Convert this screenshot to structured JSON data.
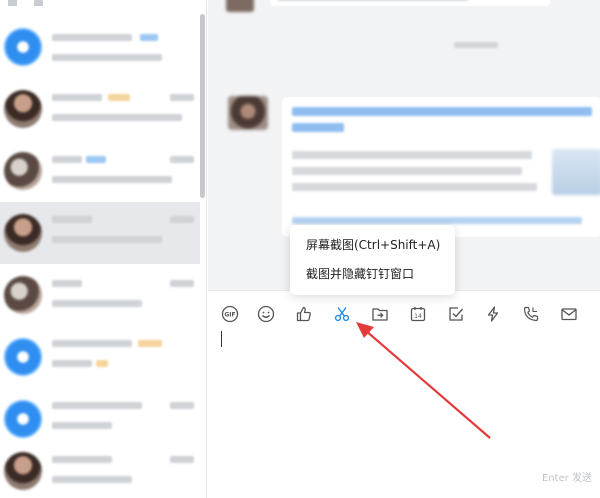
{
  "context_menu": {
    "items": [
      {
        "label": "屏幕截图(Ctrl+Shift+A)"
      },
      {
        "label": "截图并隐藏钉钉窗口"
      }
    ]
  },
  "composer": {
    "send_hint": "Enter 发送",
    "toolbar": [
      {
        "name": "gif-icon"
      },
      {
        "name": "emoji-icon"
      },
      {
        "name": "thumbs-up-icon"
      },
      {
        "name": "scissors-icon",
        "highlighted": true
      },
      {
        "name": "folder-send-icon"
      },
      {
        "name": "calendar-icon"
      },
      {
        "name": "checkbox-icon"
      },
      {
        "name": "lightning-icon"
      },
      {
        "name": "phone-icon"
      },
      {
        "name": "mail-icon"
      }
    ]
  },
  "colors": {
    "accent": "#1f8ef1",
    "arrow": "#e33b3b",
    "chat_bg": "#f2f3f5",
    "selected_row": "#e7e8eb"
  }
}
